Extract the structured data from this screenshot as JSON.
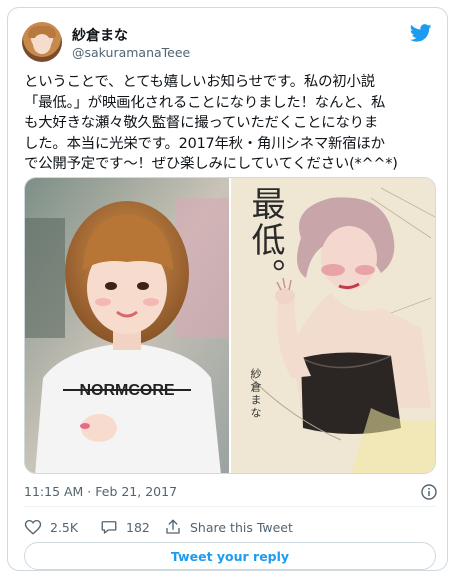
{
  "author": {
    "display_name": "紗倉まな",
    "handle": "@sakuramanaTeee"
  },
  "tweet": {
    "lines": [
      "ということで、とても嬉しいお知らせです。私の初小説",
      "「最低。」が映画化されることになりました！なんと、私",
      "も大好きな瀬々敬久監督に撮っていただくことになりま",
      "した。本当に光栄です。2017年秋・角川シネマ新宿ほか",
      "で公開予定です〜！ぜひ楽しみにしていてください(*^^*)"
    ]
  },
  "media": {
    "left_photo": {
      "shirt_text": "NORMCORE"
    },
    "book_cover": {
      "title": "最低。",
      "author": "紗倉まな"
    }
  },
  "meta": {
    "timestamp": "11:15 AM · Feb 21, 2017"
  },
  "actions": {
    "likes": "2.5K",
    "replies": "182",
    "share_label": "Share this Tweet"
  },
  "reply_button_label": "Tweet your reply",
  "colors": {
    "accent": "#1d9bf0",
    "text_primary": "#0f1419",
    "text_secondary": "#536471",
    "border": "#cfd9de"
  },
  "icons": [
    "twitter-bird-icon",
    "info-icon",
    "heart-icon",
    "reply-bubble-icon",
    "share-icon"
  ]
}
